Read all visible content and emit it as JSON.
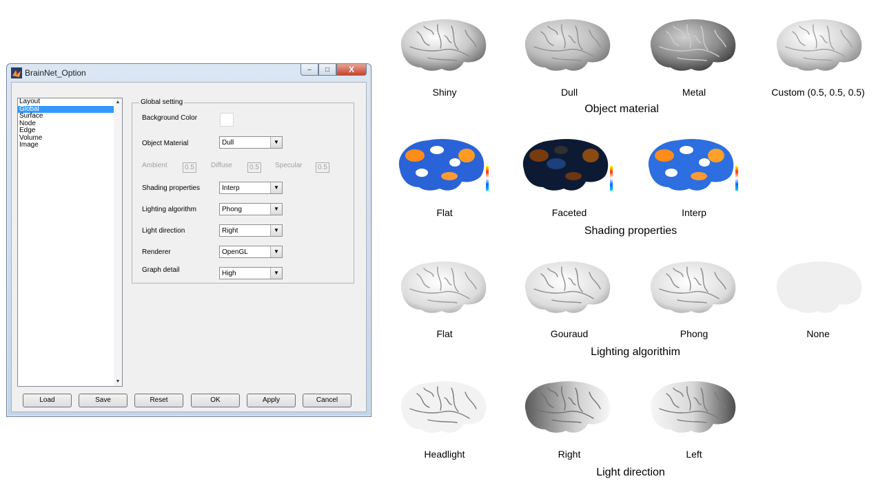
{
  "window": {
    "title": "BrainNet_Option",
    "controls": {
      "minimize": "‒",
      "maximize": "□",
      "close": "X"
    }
  },
  "list": {
    "items": [
      "Layout",
      "Global",
      "Surface",
      "Node",
      "Edge",
      "Volume",
      "Image"
    ],
    "selected": "Global"
  },
  "global": {
    "group_title": "Global setting",
    "background_color_label": "Background Color",
    "background_color": "#ffffff",
    "object_material_label": "Object Material",
    "object_material_value": "Dull",
    "ambient_label": "Ambient",
    "ambient_value": "0.5",
    "diffuse_label": "Diffuse",
    "diffuse_value": "0.5",
    "specular_label": "Specular",
    "specular_value": "0.5",
    "shading_label": "Shading properties",
    "shading_value": "Interp",
    "lighting_label": "Lighting algorithm",
    "lighting_value": "Phong",
    "light_direction_label": "Light direction",
    "light_direction_value": "Right",
    "renderer_label": "Renderer",
    "renderer_value": "OpenGL",
    "graph_detail_label": "Graph detail",
    "graph_detail_value": "High"
  },
  "buttons": {
    "load": "Load",
    "save": "Save",
    "reset": "Reset",
    "ok": "OK",
    "apply": "Apply",
    "cancel": "Cancel"
  },
  "figure": {
    "material": {
      "section": "Object material",
      "items": [
        "Shiny",
        "Dull",
        "Metal",
        "Custom (0.5, 0.5, 0.5)"
      ]
    },
    "shading": {
      "section": "Shading properties",
      "items": [
        "Flat",
        "Faceted",
        "Interp"
      ]
    },
    "lighting": {
      "section": "Lighting algorithim",
      "items": [
        "Flat",
        "Gouraud",
        "Phong",
        "None"
      ]
    },
    "light_direction": {
      "section": "Light direction",
      "items": [
        "Headlight",
        "Right",
        "Left"
      ]
    }
  },
  "colors": {
    "selection": "#3399ff",
    "close_button": "#c7432b"
  }
}
